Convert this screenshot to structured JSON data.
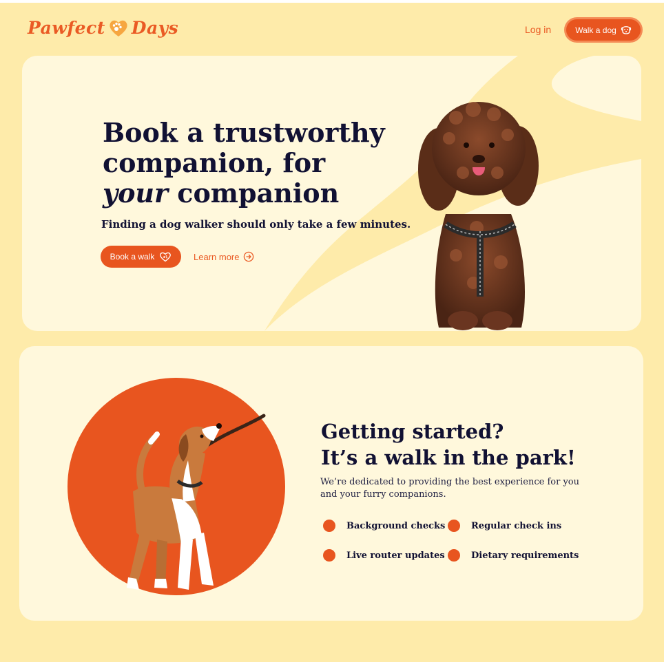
{
  "header": {
    "logo_left": "Pawfect",
    "logo_right": "Days",
    "login": "Log in",
    "walk_button": "Walk a dog"
  },
  "hero": {
    "title_line1": "Book a trustworthy",
    "title_line2": "companion, for",
    "title_emphasis": "your",
    "title_line3_rest": " companion",
    "subtitle": "Finding a dog walker should only take a few minutes.",
    "book_button": "Book a walk",
    "learn_more": "Learn more"
  },
  "getting_started": {
    "title_line1": "Getting started?",
    "title_line2": "It’s a walk in the park!",
    "description": "We’re dedicated to providing the best experience for you and your furry companions.",
    "features": [
      "Background checks",
      "Regular check ins",
      "Live router updates",
      "Dietary requirements"
    ]
  },
  "colors": {
    "background": "#FEEBAA",
    "card": "#FFF8DC",
    "accent": "#E8551F",
    "heading": "#111133"
  },
  "icons": {
    "logo": "paw-heart-icon",
    "walk": "dog-face-icon",
    "book": "heart-paw-icon",
    "learn": "arrow-circle-right-icon",
    "feature": "dot-icon"
  }
}
